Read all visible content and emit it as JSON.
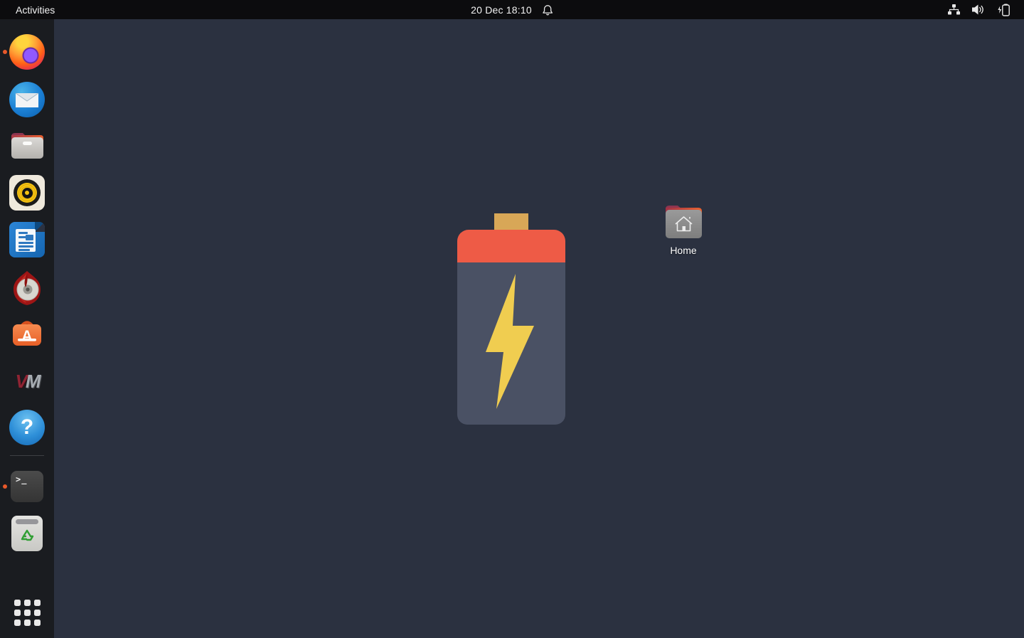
{
  "top_bar": {
    "activities_label": "Activities",
    "clock_text": "20 Dec 18:10",
    "icons": [
      "bell-icon",
      "wired-network-icon",
      "volume-icon",
      "battery-charging-icon"
    ]
  },
  "dock": {
    "items": [
      {
        "icon": "firefox-icon",
        "running": true
      },
      {
        "icon": "thunderbird-icon",
        "running": false
      },
      {
        "icon": "files-folder-icon",
        "running": false
      },
      {
        "icon": "rhythmbox-icon",
        "running": false
      },
      {
        "icon": "libreoffice-writer-icon",
        "running": false
      },
      {
        "icon": "brasero-disc-burner-icon",
        "running": false
      },
      {
        "icon": "ubuntu-software-icon",
        "running": false
      },
      {
        "icon": "vmware-icon",
        "running": false
      },
      {
        "icon": "help-icon",
        "running": false
      },
      {
        "icon": "terminal-icon",
        "running": true
      },
      {
        "icon": "trash-icon",
        "running": false
      },
      {
        "icon": "show-applications-icon",
        "running": false
      }
    ],
    "vmware_text_v": "V",
    "vmware_text_m": "M",
    "terminal_prompt": ">_"
  },
  "desktop": {
    "home_icon_label": "Home",
    "wallpaper": "battery-charging-artwork"
  },
  "colors": {
    "top_bar_background": "#0c0c0e",
    "dock_background": "#1a1c20",
    "desktop_background": "#2b3140",
    "running_indicator": "#e8582a",
    "battery_cap": "#d8a757",
    "battery_top": "#ee5b46",
    "battery_body": "#4a5164",
    "battery_bolt": "#f0cd50",
    "home_folder_gray": "#8f8f8f",
    "home_folder_tab": "#8e3550",
    "home_folder_strip": "#e8602f"
  }
}
